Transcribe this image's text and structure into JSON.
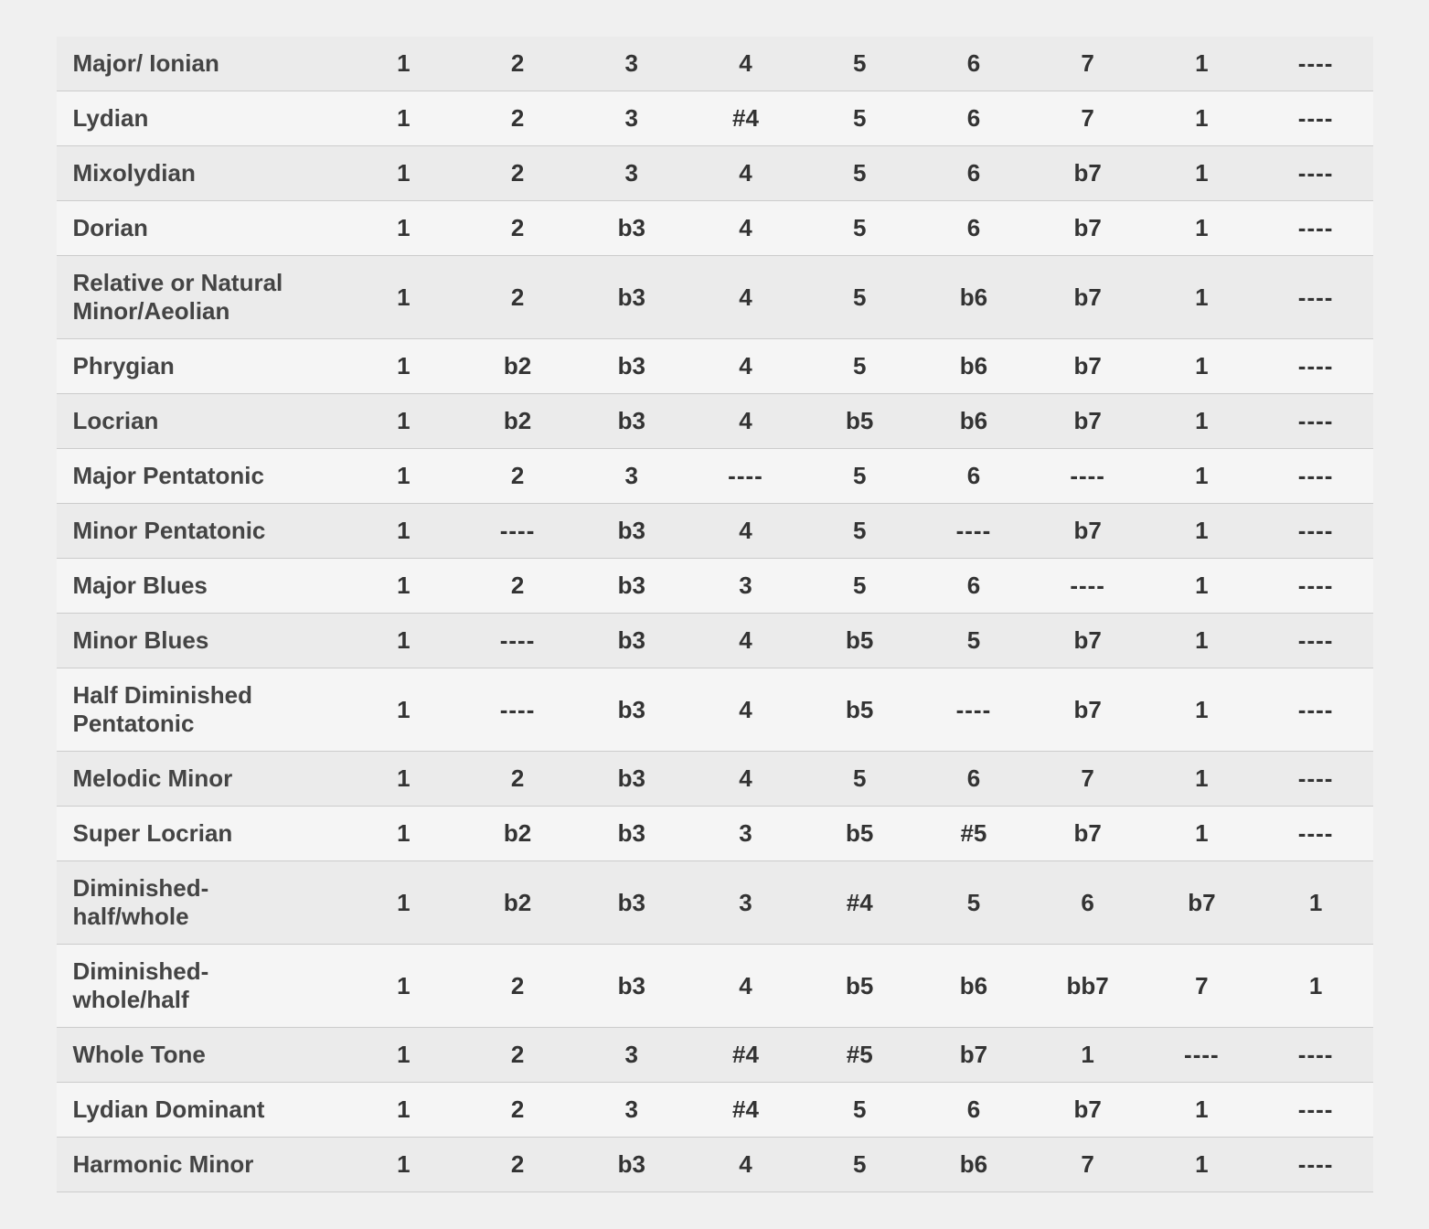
{
  "scales": [
    {
      "name": "Major/ Ionian",
      "notes": [
        "1",
        "2",
        "3",
        "4",
        "5",
        "6",
        "7",
        "1",
        "----"
      ]
    },
    {
      "name": "Lydian",
      "notes": [
        "1",
        "2",
        "3",
        "#4",
        "5",
        "6",
        "7",
        "1",
        "----"
      ]
    },
    {
      "name": "Mixolydian",
      "notes": [
        "1",
        "2",
        "3",
        "4",
        "5",
        "6",
        "b7",
        "1",
        "----"
      ]
    },
    {
      "name": "Dorian",
      "notes": [
        "1",
        "2",
        "b3",
        "4",
        "5",
        "6",
        "b7",
        "1",
        "----"
      ]
    },
    {
      "name": "Relative or Natural\nMinor/Aeolian",
      "notes": [
        "1",
        "2",
        "b3",
        "4",
        "5",
        "b6",
        "b7",
        "1",
        "----"
      ]
    },
    {
      "name": "Phrygian",
      "notes": [
        "1",
        "b2",
        "b3",
        "4",
        "5",
        "b6",
        "b7",
        "1",
        "----"
      ]
    },
    {
      "name": "Locrian",
      "notes": [
        "1",
        "b2",
        "b3",
        "4",
        "b5",
        "b6",
        "b7",
        "1",
        "----"
      ]
    },
    {
      "name": "Major Pentatonic",
      "notes": [
        "1",
        "2",
        "3",
        "----",
        "5",
        "6",
        "----",
        "1",
        "----"
      ]
    },
    {
      "name": "Minor Pentatonic",
      "notes": [
        "1",
        "----",
        "b3",
        "4",
        "5",
        "----",
        "b7",
        "1",
        "----"
      ]
    },
    {
      "name": "Major Blues",
      "notes": [
        "1",
        "2",
        "b3",
        "3",
        "5",
        "6",
        "----",
        "1",
        "----"
      ]
    },
    {
      "name": "Minor Blues",
      "notes": [
        "1",
        "----",
        "b3",
        "4",
        "b5",
        "5",
        "b7",
        "1",
        "----"
      ]
    },
    {
      "name": "Half Diminished\nPentatonic",
      "notes": [
        "1",
        "----",
        "b3",
        "4",
        "b5",
        "----",
        "b7",
        "1",
        "----"
      ]
    },
    {
      "name": "Melodic Minor",
      "notes": [
        "1",
        "2",
        "b3",
        "4",
        "5",
        "6",
        "7",
        "1",
        "----"
      ]
    },
    {
      "name": "Super Locrian",
      "notes": [
        "1",
        "b2",
        "b3",
        "3",
        "b5",
        "#5",
        "b7",
        "1",
        "----"
      ]
    },
    {
      "name": "Diminished- half/whole",
      "notes": [
        "1",
        "b2",
        "b3",
        "3",
        "#4",
        "5",
        "6",
        "b7",
        "1"
      ]
    },
    {
      "name": "Diminished- whole/half",
      "notes": [
        "1",
        "2",
        "b3",
        "4",
        "b5",
        "b6",
        "bb7",
        "7",
        "1"
      ]
    },
    {
      "name": "Whole Tone",
      "notes": [
        "1",
        "2",
        "3",
        "#4",
        "#5",
        "b7",
        "1",
        "----",
        "----"
      ]
    },
    {
      "name": "Lydian Dominant",
      "notes": [
        "1",
        "2",
        "3",
        "#4",
        "5",
        "6",
        "b7",
        "1",
        "----"
      ]
    },
    {
      "name": "Harmonic Minor",
      "notes": [
        "1",
        "2",
        "b3",
        "4",
        "5",
        "b6",
        "7",
        "1",
        "----"
      ]
    }
  ]
}
